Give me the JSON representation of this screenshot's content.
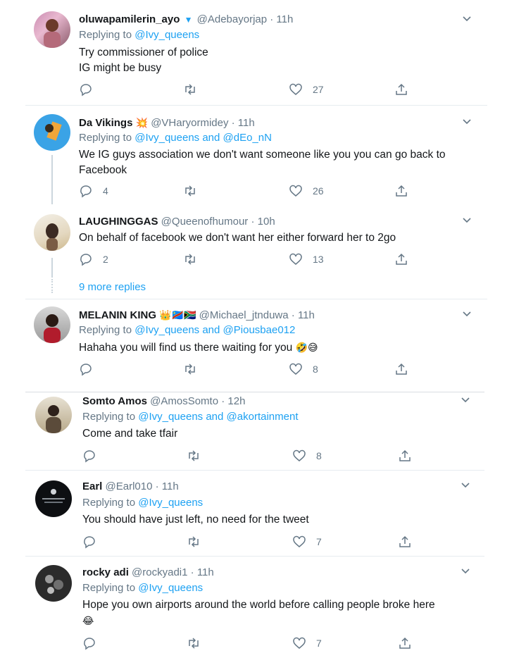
{
  "tweets": [
    {
      "name": "oluwapamilerin_ayo",
      "badge": "verified-badge",
      "handle": "@Adebayorjap",
      "time": "· 11h",
      "reply_prefix": "Replying to",
      "reply_to": "@Ivy_queens",
      "reply_and": "",
      "reply_to2": "",
      "text_lines": [
        "Try commissioner of police",
        "IG might be busy"
      ],
      "counts": {
        "reply": "",
        "retweet": "",
        "like": "27"
      }
    },
    {
      "name": "Da Vikings",
      "badge_emoji": "💥",
      "handle": "@VHaryormidey",
      "time": "· 11h",
      "reply_prefix": "Replying to",
      "reply_to": "@Ivy_queens",
      "reply_and": "and",
      "reply_to2": "@dEo_nN",
      "text_lines": [
        "We IG guys association we don't want someone like you you can go back to",
        "Facebook"
      ],
      "counts": {
        "reply": "4",
        "retweet": "",
        "like": "26"
      }
    },
    {
      "name": "LAUGHINGGAS",
      "handle": "@Queenofhumour",
      "time": "· 10h",
      "text_lines": [
        "On behalf of facebook we don't want her either forward her to 2go"
      ],
      "counts": {
        "reply": "2",
        "retweet": "",
        "like": "13"
      }
    },
    {
      "name": "MELANIN KING",
      "badge_emoji": "👑🇨🇩🇿🇦",
      "handle": "@Michael_jtnduwa",
      "time": "· 11h",
      "reply_prefix": "Replying to",
      "reply_to": "@Ivy_queens",
      "reply_and": "and",
      "reply_to2": "@Piousbae012",
      "text_lines": [
        "Hahaha you will find us there waiting for you"
      ],
      "emoji_after": [
        "🤣",
        "😅"
      ],
      "counts": {
        "reply": "",
        "retweet": "",
        "like": "8"
      }
    },
    {
      "name": "Somto Amos",
      "handle": "@AmosSomto",
      "time": "· 12h",
      "reply_prefix": "Replying to",
      "reply_to": "@Ivy_queens",
      "reply_and": "and",
      "reply_to2": "@akortainment",
      "text_lines": [
        "Come and take tfair"
      ],
      "counts": {
        "reply": "",
        "retweet": "",
        "like": "8"
      }
    },
    {
      "name": "Earl",
      "handle": "@Earl010",
      "time": "· 11h",
      "reply_prefix": "Replying to",
      "reply_to": "@Ivy_queens",
      "text_lines": [
        "You should have just left, no need for the tweet"
      ],
      "counts": {
        "reply": "",
        "retweet": "",
        "like": "7"
      }
    },
    {
      "name": "rocky adi",
      "handle": "@rockyadi1",
      "time": "· 11h",
      "reply_prefix": "Replying to",
      "reply_to": "@Ivy_queens",
      "text_lines": [
        "Hope you own airports around the world before calling people broke here"
      ],
      "emoji_line2": "😂",
      "counts": {
        "reply": "",
        "retweet": "",
        "like": "7"
      }
    }
  ],
  "more_replies": "9 more replies",
  "colors": {
    "accent": "#1da1f2",
    "muted": "#657786",
    "text": "#14171a",
    "divider": "#e6ecf0"
  }
}
